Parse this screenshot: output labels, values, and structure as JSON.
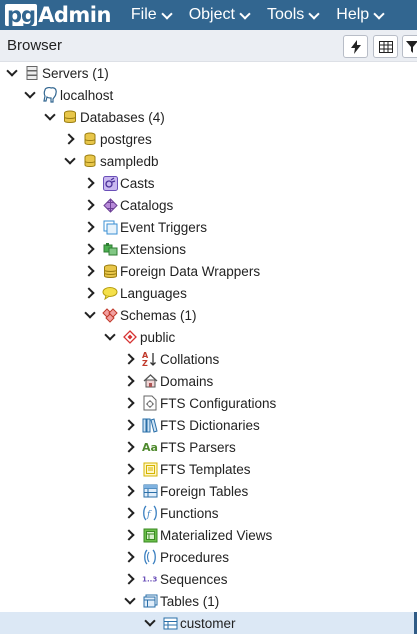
{
  "app": {
    "logo_prefix": "pg",
    "logo_suffix": "Admin",
    "menu": [
      "File",
      "Object",
      "Tools",
      "Help"
    ]
  },
  "browser": {
    "title": "Browser"
  },
  "tree": [
    {
      "label": "Servers (1)",
      "icon": "servers-icon",
      "expanded": true
    },
    {
      "label": "localhost",
      "icon": "postgres-elephant-icon",
      "expanded": true
    },
    {
      "label": "Databases (4)",
      "icon": "databases-icon",
      "expanded": true
    },
    {
      "label": "postgres",
      "icon": "database-icon",
      "expanded": false
    },
    {
      "label": "sampledb",
      "icon": "database-icon",
      "expanded": true
    },
    {
      "label": "Casts",
      "icon": "casts-icon",
      "expanded": false
    },
    {
      "label": "Catalogs",
      "icon": "catalogs-icon",
      "expanded": false
    },
    {
      "label": "Event Triggers",
      "icon": "event-triggers-icon",
      "expanded": false
    },
    {
      "label": "Extensions",
      "icon": "extensions-icon",
      "expanded": false
    },
    {
      "label": "Foreign Data Wrappers",
      "icon": "foreign-data-wrappers-icon",
      "expanded": false
    },
    {
      "label": "Languages",
      "icon": "languages-icon",
      "expanded": false
    },
    {
      "label": "Schemas (1)",
      "icon": "schemas-icon",
      "expanded": true
    },
    {
      "label": "public",
      "icon": "schema-icon",
      "expanded": true
    },
    {
      "label": "Collations",
      "icon": "collations-icon",
      "expanded": false
    },
    {
      "label": "Domains",
      "icon": "domains-icon",
      "expanded": false
    },
    {
      "label": "FTS Configurations",
      "icon": "fts-configurations-icon",
      "expanded": false
    },
    {
      "label": "FTS Dictionaries",
      "icon": "fts-dictionaries-icon",
      "expanded": false
    },
    {
      "label": "FTS Parsers",
      "icon": "fts-parsers-icon",
      "expanded": false
    },
    {
      "label": "FTS Templates",
      "icon": "fts-templates-icon",
      "expanded": false
    },
    {
      "label": "Foreign Tables",
      "icon": "foreign-tables-icon",
      "expanded": false
    },
    {
      "label": "Functions",
      "icon": "functions-icon",
      "expanded": false
    },
    {
      "label": "Materialized Views",
      "icon": "materialized-views-icon",
      "expanded": false
    },
    {
      "label": "Procedures",
      "icon": "procedures-icon",
      "expanded": false
    },
    {
      "label": "Sequences",
      "icon": "sequences-icon",
      "expanded": false
    },
    {
      "label": "Tables (1)",
      "icon": "tables-icon",
      "expanded": true
    },
    {
      "label": "customer",
      "icon": "table-icon",
      "expanded": true,
      "selected": true
    }
  ],
  "colors": {
    "topbar": "#326690",
    "header": "#ebeef3",
    "selected_row": "#dce8f5"
  }
}
